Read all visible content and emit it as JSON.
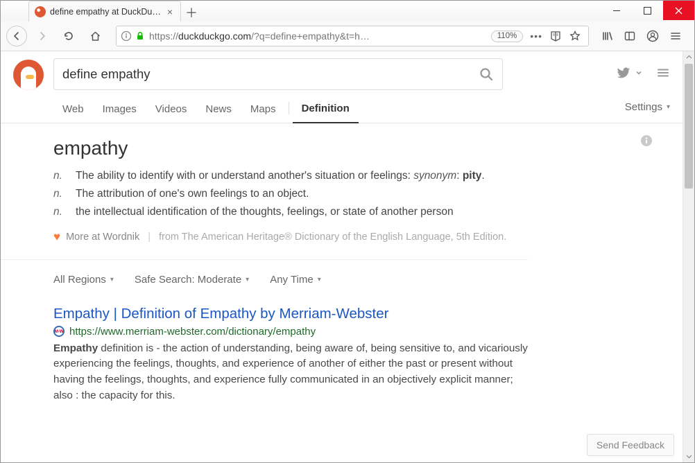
{
  "browser": {
    "tab_title": "define empathy at DuckDuckGo",
    "url_prefix": "https://",
    "url_host": "duckduckgo.com",
    "url_path": "/?q=define+empathy&t=h",
    "zoom": "110%"
  },
  "search": {
    "query": "define empathy"
  },
  "nav": {
    "items": [
      "Web",
      "Images",
      "Videos",
      "News",
      "Maps"
    ],
    "active": "Definition",
    "settings": "Settings"
  },
  "definition": {
    "word": "empathy",
    "senses": [
      {
        "pos": "n.",
        "text": "The ability to identify with or understand another's situation or feelings: ",
        "synonym_label": "synonym",
        "synonym": "pity"
      },
      {
        "pos": "n.",
        "text": "The attribution of one's own feelings to an object."
      },
      {
        "pos": "n.",
        "text": "the intellectual identification of the thoughts, feelings, or state of another person"
      }
    ],
    "more_label": "More at Wordnik",
    "source": "from The American Heritage® Dictionary of the English Language, 5th Edition."
  },
  "filters": {
    "region": "All Regions",
    "safesearch": "Safe Search: Moderate",
    "time": "Any Time"
  },
  "results": [
    {
      "title": "Empathy | Definition of Empathy by Merriam-Webster",
      "url": "https://www.merriam-webster.com/dictionary/empathy",
      "snippet_bold": "Empathy",
      "snippet_rest": " definition is - the action of understanding, being aware of, being sensitive to, and vicariously experiencing the feelings, thoughts, and experience of another of either the past or present without having the feelings, thoughts, and experience fully communicated in an objectively explicit manner; also : the capacity for this."
    }
  ],
  "feedback": "Send Feedback"
}
